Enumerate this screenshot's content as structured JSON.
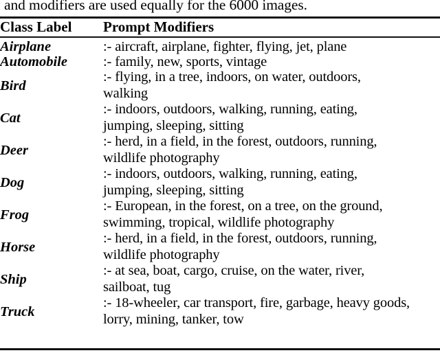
{
  "caption_tail": "and modifiers are used equally for the 6000 images.",
  "table": {
    "columns": {
      "class_label": "Class Label",
      "prompt_modifiers": "Prompt Modifiers"
    },
    "rows": [
      {
        "class_label": "Airplane",
        "lines": [
          ":- aircraft, airplane, fighter, flying, jet, plane"
        ]
      },
      {
        "class_label": "Automobile",
        "lines": [
          ":- family, new, sports, vintage"
        ]
      },
      {
        "class_label": "Bird",
        "lines": [
          ":- flying, in a tree, indoors, on water, outdoors,",
          "walking"
        ]
      },
      {
        "class_label": "Cat",
        "lines": [
          ":- indoors, outdoors, walking, running, eating,",
          "jumping, sleeping, sitting"
        ]
      },
      {
        "class_label": "Deer",
        "lines": [
          ":- herd, in a field, in the forest, outdoors, running,",
          "wildlife photography"
        ]
      },
      {
        "class_label": "Dog",
        "lines": [
          ":- indoors, outdoors, walking, running, eating,",
          "jumping, sleeping, sitting"
        ]
      },
      {
        "class_label": "Frog",
        "lines": [
          ":- European, in the forest, on a tree, on the ground,",
          "swimming, tropical, wildlife photography"
        ]
      },
      {
        "class_label": "Horse",
        "lines": [
          ":- herd, in a field, in the forest, outdoors, running,",
          "wildlife photography"
        ]
      },
      {
        "class_label": "Ship",
        "lines": [
          ":- at sea, boat, cargo, cruise, on the water, river,",
          "sailboat, tug"
        ]
      },
      {
        "class_label": "Truck",
        "lines": [
          ":- 18-wheeler, car transport, fire, garbage, heavy goods,",
          "lorry, mining, tanker, tow"
        ]
      }
    ]
  }
}
